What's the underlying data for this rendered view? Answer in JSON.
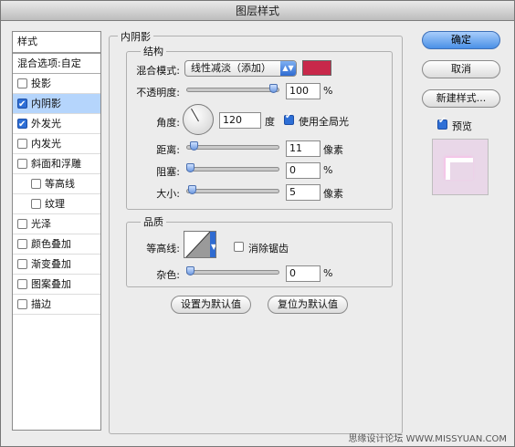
{
  "window": {
    "title": "图层样式"
  },
  "sidebar": {
    "header": "样式",
    "blend_options": "混合选项:自定",
    "items": [
      {
        "label": "投影",
        "checked": false
      },
      {
        "label": "内阴影",
        "checked": true,
        "selected": true
      },
      {
        "label": "外发光",
        "checked": true
      },
      {
        "label": "内发光",
        "checked": false
      },
      {
        "label": "斜面和浮雕",
        "checked": false
      },
      {
        "label": "等高线",
        "checked": false,
        "sub": true
      },
      {
        "label": "纹理",
        "checked": false,
        "sub": true
      },
      {
        "label": "光泽",
        "checked": false
      },
      {
        "label": "颜色叠加",
        "checked": false
      },
      {
        "label": "渐变叠加",
        "checked": false
      },
      {
        "label": "图案叠加",
        "checked": false
      },
      {
        "label": "描边",
        "checked": false
      }
    ]
  },
  "inner_shadow": {
    "section_title": "内阴影",
    "structure": {
      "title": "结构",
      "blend_mode_label": "混合模式:",
      "blend_mode_value": "线性减淡（添加）",
      "shadow_color": "#c8284a",
      "opacity_label": "不透明度:",
      "opacity_value": "100",
      "opacity_unit": "%",
      "opacity_fraction": 1.0,
      "angle_label": "角度:",
      "angle_value": "120",
      "angle_unit": "度",
      "global_light_label": "使用全局光",
      "global_light_checked": true,
      "distance_label": "距离:",
      "distance_value": "11",
      "distance_unit": "像素",
      "distance_fraction": 0.045,
      "choke_label": "阻塞:",
      "choke_value": "0",
      "choke_unit": "%",
      "choke_fraction": 0.0,
      "size_label": "大小:",
      "size_value": "5",
      "size_unit": "像素",
      "size_fraction": 0.02
    },
    "quality": {
      "title": "品质",
      "contour_label": "等高线:",
      "anti_alias_label": "消除锯齿",
      "anti_alias_checked": false,
      "noise_label": "杂色:",
      "noise_value": "0",
      "noise_unit": "%",
      "noise_fraction": 0.0
    },
    "make_default": "设置为默认值",
    "reset_default": "复位为默认值"
  },
  "actions": {
    "ok": "确定",
    "cancel": "取消",
    "new_style": "新建样式...",
    "preview_label": "预览",
    "preview_checked": true
  },
  "watermark": "思缘设计论坛 WWW.MISSYUAN.COM"
}
